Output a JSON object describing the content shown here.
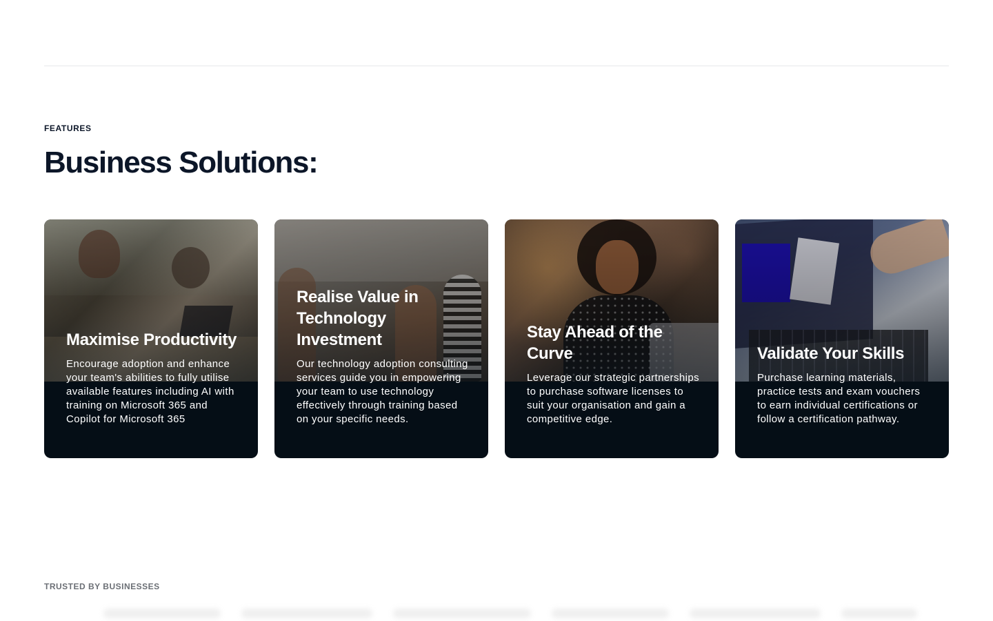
{
  "section": {
    "eyebrow": "FEATURES",
    "title": "Business Solutions:"
  },
  "cards": [
    {
      "title": "Maximise Productivity",
      "description": "Encourage adoption and enhance your team's abilities to fully utilise available features including AI with training on Microsoft 365 and Copilot for Microsoft 365"
    },
    {
      "title": "Realise Value in Technology Investment",
      "description": "Our technology adoption consulting services guide you in empowering your team to use technology effectively through training based on your specific needs."
    },
    {
      "title": "Stay Ahead of the Curve",
      "description": "Leverage our strategic partnerships to purchase software licenses to suit your organisation and gain a competitive edge."
    },
    {
      "title": "Validate Your Skills",
      "description": "Purchase learning materials, practice tests and exam vouchers to earn individual certifications or follow a certification pathway."
    }
  ],
  "trusted": {
    "label": "TRUSTED BY BUSINESSES"
  },
  "colors": {
    "heading": "#0c1628",
    "card_background": "#050e16",
    "card_text": "#ffffff",
    "muted_label": "#6b6f75"
  }
}
